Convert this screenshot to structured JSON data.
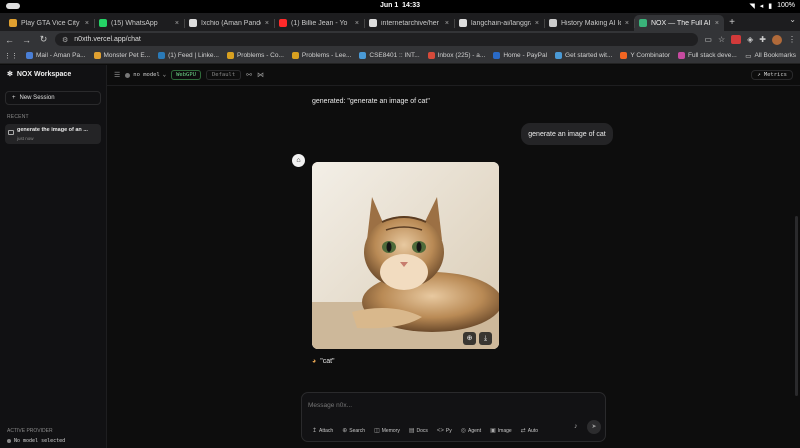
{
  "os": {
    "date": "Jun 1",
    "time": "14:33",
    "battery": "100%"
  },
  "browser": {
    "tabs": [
      {
        "title": "Play GTA Vice City C",
        "color": "#e0a030"
      },
      {
        "title": "(15) WhatsApp",
        "color": "#25d366"
      },
      {
        "title": "Ixchio (Aman Pandey)",
        "color": "#dddddd"
      },
      {
        "title": "(1) Billie Jean - Yo",
        "color": "#ff2a2a"
      },
      {
        "title": "internetarchive/her",
        "color": "#dddddd"
      },
      {
        "title": "langchain-ai/langgra",
        "color": "#dddddd"
      },
      {
        "title": "History Making AI Ide",
        "color": "#cccccc"
      },
      {
        "title": "NOX — The Full AI St",
        "color": "#3ab37a"
      }
    ],
    "url": "n0xth.vercel.app/chat",
    "bookmarks": [
      {
        "label": "Mail - Aman Pa...",
        "color": "#4a7fd6"
      },
      {
        "label": "Monster Pet E...",
        "color": "#e0a030"
      },
      {
        "label": "(1) Feed | Linke...",
        "color": "#2a7ab8"
      },
      {
        "label": "Problems - Co...",
        "color": "#d8a020"
      },
      {
        "label": "Problems - Lee...",
        "color": "#d8a020"
      },
      {
        "label": "CSE8401 :: INT...",
        "color": "#4a9ad6"
      },
      {
        "label": "Inbox (225) - a...",
        "color": "#d64a3a"
      },
      {
        "label": "Home - PayPal",
        "color": "#2a6ac6"
      },
      {
        "label": "Get started wit...",
        "color": "#4a9ad6"
      },
      {
        "label": "Y Combinator",
        "color": "#f26522"
      },
      {
        "label": "Full stack deve...",
        "color": "#c64aa0"
      }
    ],
    "all_bookmarks": "All Bookmarks"
  },
  "sidebar": {
    "brand": "NOX Workspace",
    "new_session": "New Session",
    "recent_label": "RECENT",
    "session": {
      "title": "generate the image of an ...",
      "time": "just now"
    },
    "active_provider_label": "ACTIVE PROVIDER",
    "active_provider_value": "No model selected"
  },
  "topbar": {
    "model": "no model",
    "webgpu": "WebGPU",
    "default": "Default",
    "metrics": "Metrics"
  },
  "chat": {
    "generated_text": "generated: \"generate an image of cat\"",
    "user_message": "generate an image of cat",
    "caption": "\"cat\""
  },
  "composer": {
    "placeholder": "Message n0x...",
    "tools": [
      {
        "icon": "↥",
        "label": "Attach"
      },
      {
        "icon": "⊕",
        "label": "Search"
      },
      {
        "icon": "◫",
        "label": "Memory"
      },
      {
        "icon": "▤",
        "label": "Docs"
      },
      {
        "icon": "<>",
        "label": "Py"
      },
      {
        "icon": "◎",
        "label": "Agent"
      },
      {
        "icon": "▣",
        "label": "Image"
      },
      {
        "icon": "⇄",
        "label": "Auto"
      }
    ]
  }
}
